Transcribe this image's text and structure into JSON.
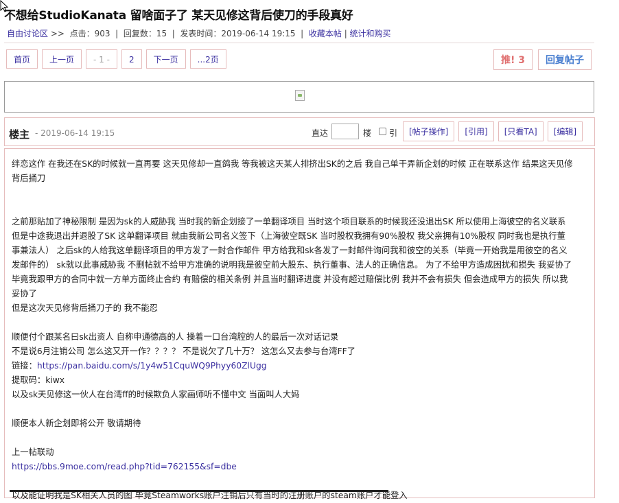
{
  "header": {
    "title": "不想给StudioKanata 留啥面子了  某天见修这背后使刀的手段真好"
  },
  "meta": {
    "board_link": "自由讨论区",
    "sep": ">>",
    "clicks_label": "点击：903",
    "replies_label": "回复数：15",
    "posted_label": "发表时间：2019-06-14 19:15",
    "favorite_link": "收藏本帖",
    "stats_link": "统计和购买"
  },
  "pager": {
    "items": [
      "首页",
      "上一页",
      "- 1 -",
      "2",
      "下一页",
      "...2页"
    ]
  },
  "actions": {
    "push_label": "推! 3",
    "reply_label": "回复帖子"
  },
  "floor": {
    "label": "楼主",
    "time": "- 2019-06-14 19:15",
    "jump_label": "直达",
    "floor_unit": "楼",
    "quote_label": "引",
    "buttons": [
      "[帖子操作]",
      "[引用]",
      "[只看TA]",
      "[编辑]"
    ]
  },
  "post": {
    "p1": "绊恋这作 在我还在SK的时候就一直再要 这天见修却一直鸽我  等我被这天某人排挤出SK的之后 我自己单干弄新企划的时候 正在联系这作 结果这天见修背后捅刀",
    "p2": "之前那贴加了神秘限制 是因为sk的人威胁我 当时我的新企划接了一单翻译项目 当时这个项目联系的时候我还没退出SK 所以使用上海彼空的名义联系 但是中途我退出并退股了SK 这单翻译项目 就由我新公司名义签下（上海彼空既SK 当时股权我拥有90%股权 我父亲拥有10%股权 同时我也是执行董事兼法人）  之后sk的人给我这单翻译项目的甲方发了一封合作邮件 甲方给我和sk各发了一封邮件询问我和彼空的关系（毕竟一开始我是用彼空的名义发邮件的）  sk就以此事威胁我 不删帖就不给甲方准确的说明我是彼空前大股东、执行董事、法人的正确信息。 为了不给甲方造成困扰和损失 我妥协了 毕竟我跟甲方的合同中就一方单方面终止合约 有赔偿的相关条例 并且当时翻译进度 并没有超过赔偿比例 我并不会有损失 但会造成甲方的损失 所以我妥协了",
    "p3": "但是这次天见修背后捅刀子的 我不能忍",
    "p4": "顺便付个跟某名曰sk出资人 自称申通德高的人 操着一口台湾腔的人的最后一次对话记录",
    "p5": "不是说6月注销公司 怎么这又开一作？？？？  不是说欠了几十万？  这怎么又去参与台湾FF了",
    "p6_prefix": "链接：",
    "p6_link": "https://pan.baidu.com/s/1y4w51CquWQ9Phyy60ZlUgg",
    "p7": "提取码：kiwx",
    "p8": "以及sk天见修这一伙人在台湾ff的时候欺负人家画师听不懂中文 当面叫人大妈",
    "p9": "顺便本人新企划即将公开 敬请期待",
    "p10": "上一帖联动",
    "p11_link": "https://bbs.9moe.com/read.php?tid=762155&sf=dbe",
    "p12": "以及能证明我是SK相关人员的图  毕竟Steamworks账户注销后只有当时的注册账户的steam账户才能登入"
  }
}
